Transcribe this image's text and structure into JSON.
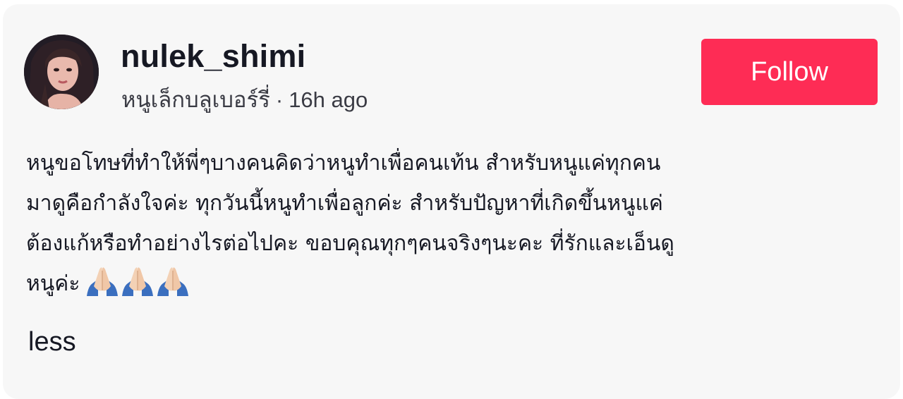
{
  "post": {
    "author": {
      "username": "nulek_shimi",
      "display_name": "หนูเล็กบลูเบอร์รี่",
      "separator": "·",
      "time_ago": "16h ago"
    },
    "follow_label": "Follow",
    "caption_lines": [
      "หนูขอโทษที่ทำให้พี่ๆบางคนคิดว่าหนูทำเพื่อคนเท้น สำหรับหนูแค่ทุกคน",
      "มาดูคือกำลังใจค่ะ ทุกวันนี้หนูทำเพื่อลูกค่ะ สำหรับปัญหาที่เกิดขึ้นหนูแค่",
      "ต้องแก้หรือทำอย่างไรต่อไปคะ ขอบคุณทุกๆคนจริงๆนะคะ ที่รักและเอ็นดู",
      "หนูค่ะ"
    ],
    "caption_emoji": "folded-hands-icon",
    "less_label": "less"
  },
  "colors": {
    "card_background": "#f7f7f7",
    "follow_button": "#fe2c55",
    "text_primary": "#161823",
    "text_secondary": "#3a3b44"
  }
}
